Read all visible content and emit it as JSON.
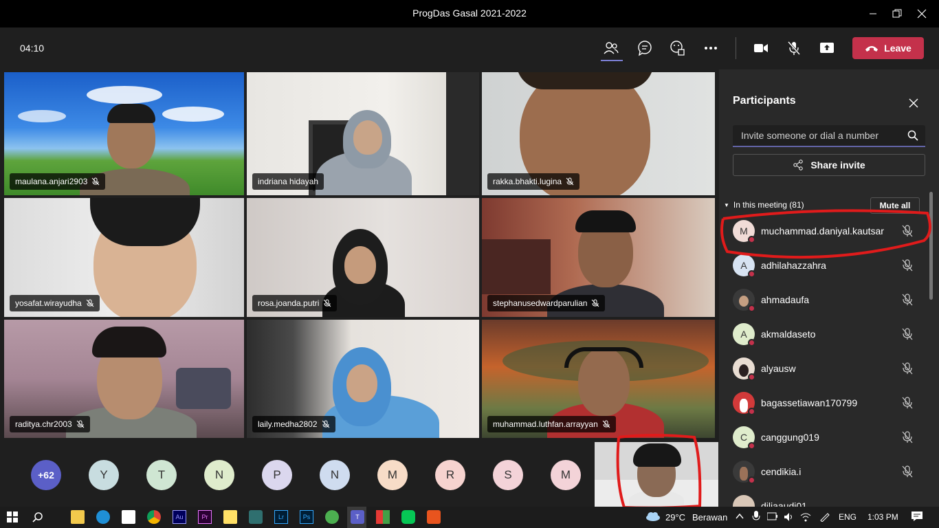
{
  "window": {
    "title": "ProgDas Gasal 2021-2022"
  },
  "toolbar": {
    "timer": "04:10",
    "leave_label": "Leave"
  },
  "tiles": [
    {
      "name": "maulana.anjari2903",
      "muted": true
    },
    {
      "name": "indriana hidayah",
      "muted": false
    },
    {
      "name": "rakka.bhakti.lugina",
      "muted": true
    },
    {
      "name": "yosafat.wirayudha",
      "muted": true
    },
    {
      "name": "rosa.joanda.putri",
      "muted": true
    },
    {
      "name": "stephanusedwardparulian",
      "muted": true
    },
    {
      "name": "raditya.chr2003",
      "muted": true
    },
    {
      "name": "laily.medha2802",
      "muted": true
    },
    {
      "name": "muhammad.luthfan.arrayyan",
      "muted": true
    }
  ],
  "overflow": {
    "more_label": "+62",
    "avatars": [
      {
        "initial": "Y",
        "color": "#c8dde0"
      },
      {
        "initial": "T",
        "color": "#cfe6d3"
      },
      {
        "initial": "N",
        "color": "#dfeccc"
      },
      {
        "initial": "P",
        "color": "#dbd7ee"
      },
      {
        "initial": "N",
        "color": "#cfdcef"
      },
      {
        "initial": "M",
        "color": "#f7dcc7"
      },
      {
        "initial": "R",
        "color": "#f6d3cf"
      },
      {
        "initial": "S",
        "color": "#f3d3d8"
      },
      {
        "initial": "M",
        "color": "#f3d3d8"
      }
    ]
  },
  "participants_panel": {
    "title": "Participants",
    "invite_placeholder": "Invite someone or dial a number",
    "share_invite_label": "Share invite",
    "section_label": "In this meeting (81)",
    "mute_all_label": "Mute all",
    "people": [
      {
        "name": "muchammad.daniyal.kautsar",
        "initial": "M",
        "color": "#f1dcd7"
      },
      {
        "name": "adhilahazzahra",
        "initial": "A",
        "color": "#d7e3f2"
      },
      {
        "name": "ahmadaufa",
        "initial": "",
        "color": "#3a3a3a"
      },
      {
        "name": "akmaldaseto",
        "initial": "A",
        "color": "#dfeccc"
      },
      {
        "name": "alyausw",
        "initial": "",
        "color": "#e9ddd2"
      },
      {
        "name": "bagassetiawan170799",
        "initial": "",
        "color": "#d23a3a"
      },
      {
        "name": "canggung019",
        "initial": "C",
        "color": "#dfeccc"
      },
      {
        "name": "cendikia.i",
        "initial": "",
        "color": "#3a3a3a"
      },
      {
        "name": "diliaaudi01",
        "initial": "",
        "color": "#d9c7b7"
      }
    ]
  },
  "taskbar": {
    "weather_temp": "29°C",
    "weather_text": "Berawan",
    "language": "ENG",
    "time": "1:03 PM"
  }
}
